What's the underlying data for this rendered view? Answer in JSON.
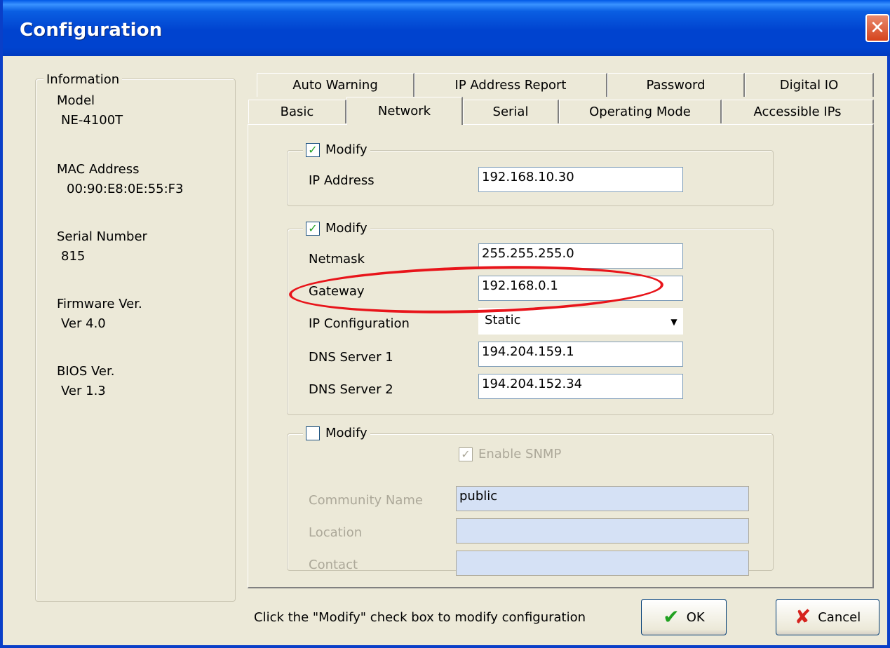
{
  "window": {
    "title": "Configuration",
    "close_glyph": "✕"
  },
  "info": {
    "legend": "Information",
    "items": [
      {
        "label": "Model",
        "value": "NE-4100T"
      },
      {
        "label": "MAC Address",
        "value": "00:90:E8:0E:55:F3"
      },
      {
        "label": "Serial Number",
        "value": "815"
      },
      {
        "label": "Firmware Ver.",
        "value": "Ver 4.0"
      },
      {
        "label": "BIOS Ver.",
        "value": "Ver 1.3"
      }
    ]
  },
  "tabs": {
    "row1": [
      "Auto Warning",
      "IP Address Report",
      "Password",
      "Digital IO"
    ],
    "row2": [
      "Basic",
      "Network",
      "Serial",
      "Operating Mode",
      "Accessible IPs"
    ],
    "active": "Network"
  },
  "group1": {
    "modify_label": "Modify",
    "modify_checked": true,
    "ip_label": "IP Address",
    "ip_value": "192.168.10.30"
  },
  "group2": {
    "modify_label": "Modify",
    "modify_checked": true,
    "netmask_label": "Netmask",
    "netmask_value": "255.255.255.0",
    "gateway_label": "Gateway",
    "gateway_value": "192.168.0.1",
    "ipconfig_label": "IP Configuration",
    "ipconfig_value": "Static",
    "dns1_label": "DNS Server 1",
    "dns1_value": "194.204.159.1",
    "dns2_label": "DNS Server 2",
    "dns2_value": "194.204.152.34"
  },
  "group3": {
    "modify_label": "Modify",
    "modify_checked": false,
    "snmp_label": "Enable SNMP",
    "snmp_checked": true,
    "community_label": "Community Name",
    "community_value": "public",
    "location_label": "Location",
    "location_value": "",
    "contact_label": "Contact",
    "contact_value": ""
  },
  "footer": {
    "hint": "Click the \"Modify\" check box to modify configuration",
    "ok_label": "OK",
    "cancel_label": "Cancel"
  },
  "colors": {
    "title_bar": "#0043cf",
    "annotation": "#e8141a",
    "ok_icon": "#21a121",
    "cancel_icon": "#d6231e"
  }
}
